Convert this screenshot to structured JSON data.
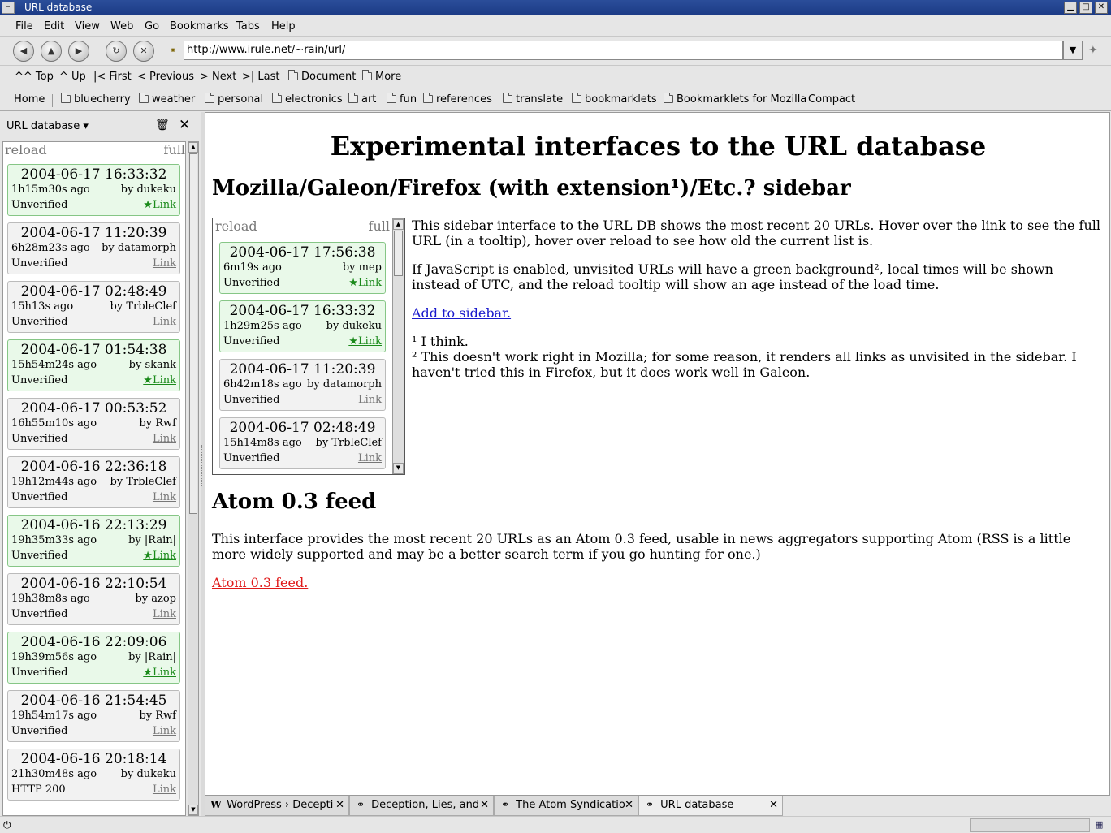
{
  "window": {
    "title": "URL database"
  },
  "menu": [
    {
      "label": "File"
    },
    {
      "label": "Edit"
    },
    {
      "label": "View"
    },
    {
      "label": "Web"
    },
    {
      "label": "Go"
    },
    {
      "label": "Bookmarks"
    },
    {
      "label": "Tabs"
    },
    {
      "label": "Help"
    }
  ],
  "location": {
    "url": "http://www.irule.net/~rain/url/"
  },
  "linkbar": {
    "top": "^^ Top",
    "up": "^ Up",
    "first": "|< First",
    "previous": "< Previous",
    "next": "> Next",
    "last": ">| Last",
    "document": "Document",
    "more": "More"
  },
  "bookmarks": {
    "home": "Home",
    "folders": [
      "bluecherry",
      "weather",
      "personal",
      "electronics",
      "art",
      "fun",
      "references",
      "translate",
      "bookmarklets",
      "Bookmarklets for Mozilla"
    ],
    "compact": "Compact"
  },
  "sidebar": {
    "title": "URL database",
    "reload": "reload",
    "full": "full",
    "entries": [
      {
        "date": "2004-06-17 16:33:32",
        "ago": "1h15m30s ago",
        "by": "by dukeku",
        "status": "Unverified",
        "link": "★Link",
        "new": true
      },
      {
        "date": "2004-06-17 11:20:39",
        "ago": "6h28m23s ago",
        "by": "by datamorph",
        "status": "Unverified",
        "link": "Link",
        "new": false
      },
      {
        "date": "2004-06-17 02:48:49",
        "ago": "15h13s ago",
        "by": "by TrbleClef",
        "status": "Unverified",
        "link": "Link",
        "new": false
      },
      {
        "date": "2004-06-17 01:54:38",
        "ago": "15h54m24s ago",
        "by": "by skank",
        "status": "Unverified",
        "link": "★Link",
        "new": true
      },
      {
        "date": "2004-06-17 00:53:52",
        "ago": "16h55m10s ago",
        "by": "by Rwf",
        "status": "Unverified",
        "link": "Link",
        "new": false
      },
      {
        "date": "2004-06-16 22:36:18",
        "ago": "19h12m44s ago",
        "by": "by TrbleClef",
        "status": "Unverified",
        "link": "Link",
        "new": false
      },
      {
        "date": "2004-06-16 22:13:29",
        "ago": "19h35m33s ago",
        "by": "by |Rain|",
        "status": "Unverified",
        "link": "★Link",
        "new": true
      },
      {
        "date": "2004-06-16 22:10:54",
        "ago": "19h38m8s ago",
        "by": "by azop",
        "status": "Unverified",
        "link": "Link",
        "new": false
      },
      {
        "date": "2004-06-16 22:09:06",
        "ago": "19h39m56s ago",
        "by": "by |Rain|",
        "status": "Unverified",
        "link": "★Link",
        "new": true
      },
      {
        "date": "2004-06-16 21:54:45",
        "ago": "19h54m17s ago",
        "by": "by Rwf",
        "status": "Unverified",
        "link": "Link",
        "new": false
      },
      {
        "date": "2004-06-16 20:18:14",
        "ago": "21h30m48s ago",
        "by": "by dukeku",
        "status": "HTTP 200",
        "link": "Link",
        "new": false
      }
    ]
  },
  "page": {
    "heading": "Experimental interfaces to the URL database",
    "sidebar_heading": "Mozilla/Galeon/Firefox (with extension¹)/Etc.? sidebar",
    "demo": {
      "reload": "reload",
      "full": "full",
      "entries": [
        {
          "date": "2004-06-17 17:56:38",
          "ago": "6m19s ago",
          "by": "by mep",
          "status": "Unverified",
          "link": "★Link",
          "new": true
        },
        {
          "date": "2004-06-17 16:33:32",
          "ago": "1h29m25s ago",
          "by": "by dukeku",
          "status": "Unverified",
          "link": "★Link",
          "new": true
        },
        {
          "date": "2004-06-17 11:20:39",
          "ago": "6h42m18s ago",
          "by": "by datamorph",
          "status": "Unverified",
          "link": "Link",
          "new": false
        },
        {
          "date": "2004-06-17 02:48:49",
          "ago": "15h14m8s ago",
          "by": "by TrbleClef",
          "status": "Unverified",
          "link": "Link",
          "new": false
        }
      ]
    },
    "p1": "This sidebar interface to the URL DB shows the most recent 20 URLs. Hover over the link to see the full URL (in a tooltip), hover over reload to see how old the current list is.",
    "p2": "If JavaScript is enabled, unvisited URLs will have a green background², local times will be shown instead of UTC, and the reload tooltip will show an age instead of the load time.",
    "add_link": "Add to sidebar.",
    "fn1": "¹ I think.",
    "fn2": "² This doesn't work right in Mozilla; for some reason, it renders all links as unvisited in the sidebar. I haven't tried this in Firefox, but it does work well in Galeon.",
    "atom_heading": "Atom 0.3 feed",
    "atom_p": "This interface provides the most recent 20 URLs as an Atom 0.3 feed, usable in news aggregators supporting Atom (RSS is a little more widely supported and may be a better search term if you go hunting for one.)",
    "atom_link": "Atom 0.3 feed."
  },
  "tabs": [
    {
      "label": "WordPress › Decepti",
      "icon": "wordpress-icon"
    },
    {
      "label": "Deception, Lies, and",
      "icon": "page-icon"
    },
    {
      "label": "The Atom Syndicatio",
      "icon": "page-icon"
    },
    {
      "label": "URL database",
      "icon": "page-icon",
      "active": true
    }
  ]
}
